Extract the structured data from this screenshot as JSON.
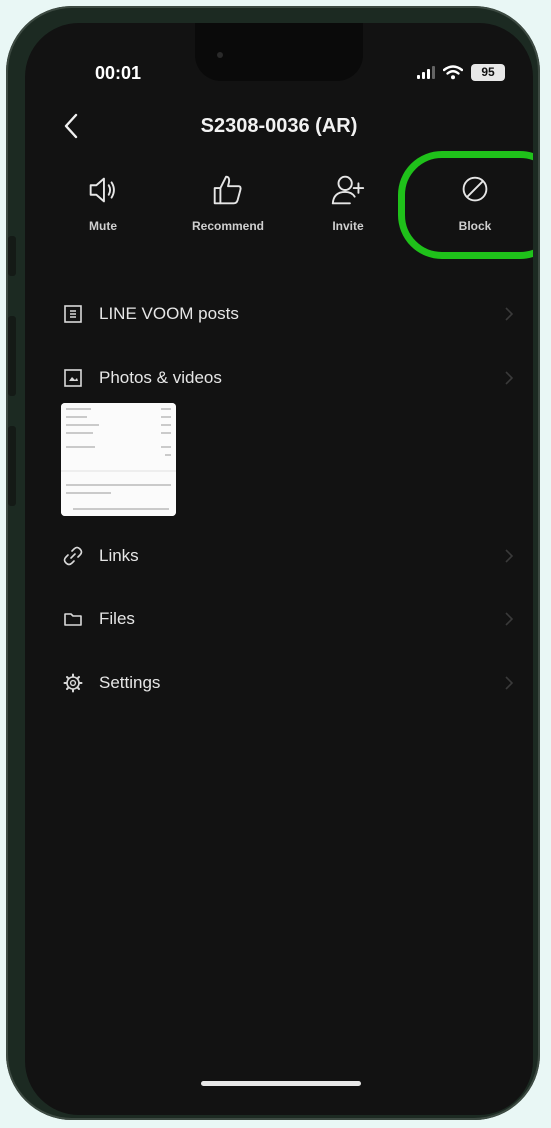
{
  "status_bar": {
    "time": "00:01",
    "battery": "95"
  },
  "header": {
    "title": "S2308-0036 (AR)"
  },
  "actions": [
    {
      "label": "Mute",
      "icon": "speaker-icon"
    },
    {
      "label": "Recommend",
      "icon": "thumbs-up-icon"
    },
    {
      "label": "Invite",
      "icon": "add-person-icon"
    },
    {
      "label": "Block",
      "icon": "block-icon"
    }
  ],
  "menu": {
    "voom": {
      "label": "LINE VOOM posts",
      "icon": "post-icon"
    },
    "photos": {
      "label": "Photos & videos",
      "icon": "image-icon"
    },
    "links": {
      "label": "Links",
      "icon": "link-icon"
    },
    "files": {
      "label": "Files",
      "icon": "folder-icon"
    },
    "settings": {
      "label": "Settings",
      "icon": "gear-icon"
    }
  },
  "colors": {
    "highlight": "#1fc11a",
    "background": "#121212"
  }
}
